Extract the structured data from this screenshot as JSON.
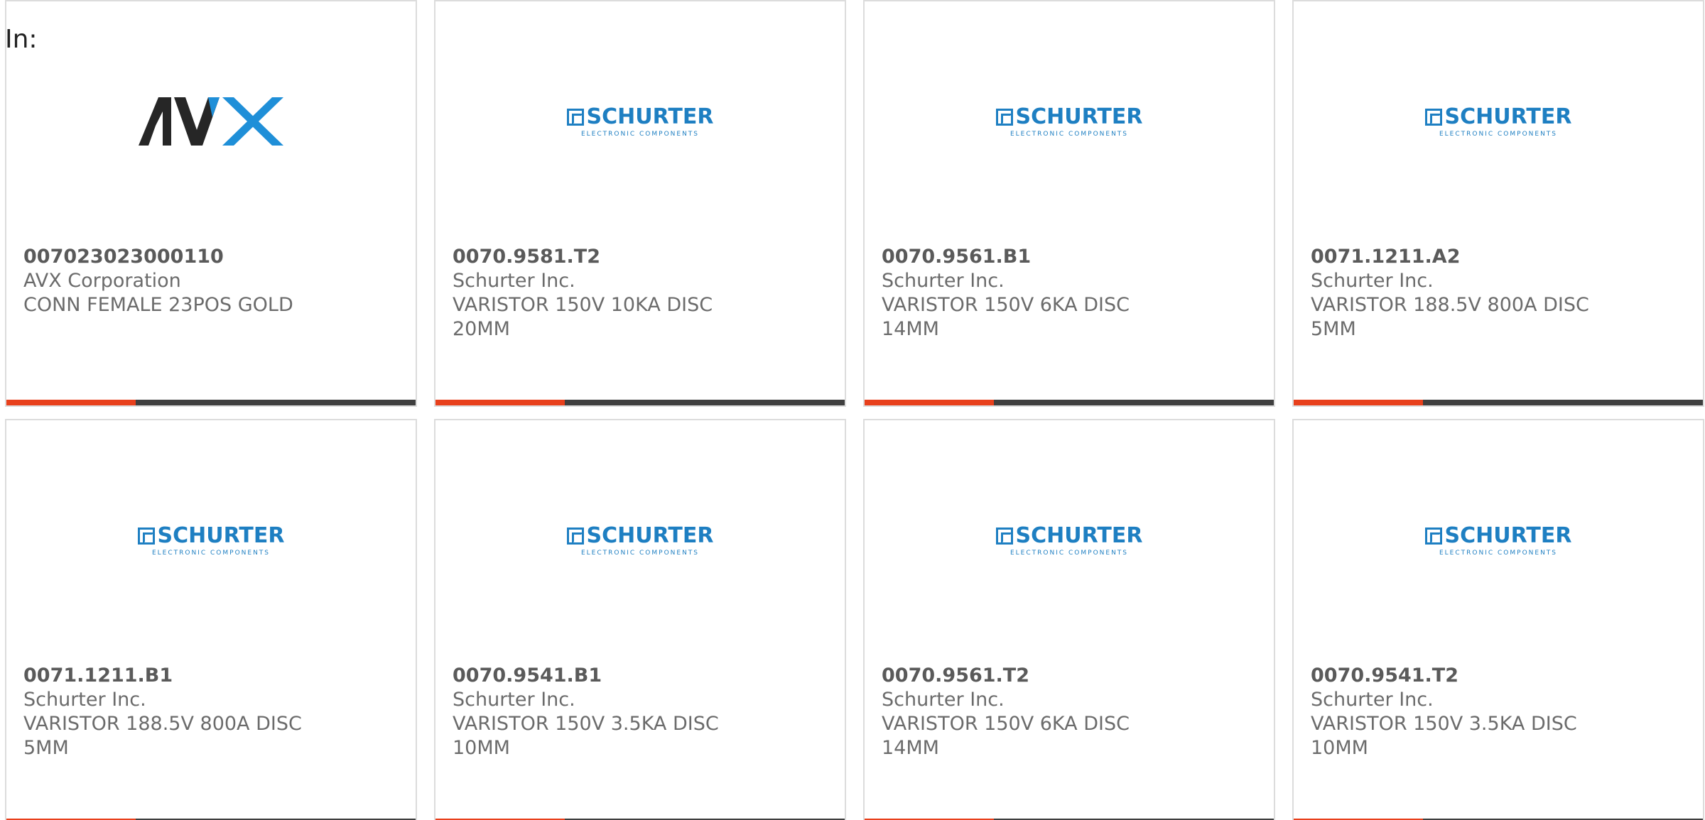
{
  "filter_label": "In:",
  "colors": {
    "accent": "#e8401c",
    "bar": "#3f3f3f",
    "avx_dark": "#262626",
    "avx_blue": "#1f8fd8",
    "schurter_blue": "#1e7fc2"
  },
  "cards": [
    {
      "logo": "avx-logo",
      "part_number": "007023023000110",
      "manufacturer": "AVX Corporation",
      "description": "CONN FEMALE 23POS GOLD"
    },
    {
      "logo": "schurter-logo",
      "logo_name": "SCHURTER",
      "logo_sub": "ELECTRONIC COMPONENTS",
      "part_number": "0070.9581.T2",
      "manufacturer": "Schurter Inc.",
      "description": "VARISTOR 150V 10KA DISC 20MM"
    },
    {
      "logo": "schurter-logo",
      "logo_name": "SCHURTER",
      "logo_sub": "ELECTRONIC COMPONENTS",
      "part_number": "0070.9561.B1",
      "manufacturer": "Schurter Inc.",
      "description": "VARISTOR 150V 6KA DISC 14MM"
    },
    {
      "logo": "schurter-logo",
      "logo_name": "SCHURTER",
      "logo_sub": "ELECTRONIC COMPONENTS",
      "part_number": "0071.1211.A2",
      "manufacturer": "Schurter Inc.",
      "description": "VARISTOR 188.5V 800A DISC 5MM"
    },
    {
      "logo": "schurter-logo",
      "logo_name": "SCHURTER",
      "logo_sub": "ELECTRONIC COMPONENTS",
      "part_number": "0071.1211.B1",
      "manufacturer": "Schurter Inc.",
      "description": "VARISTOR 188.5V 800A DISC 5MM"
    },
    {
      "logo": "schurter-logo",
      "logo_name": "SCHURTER",
      "logo_sub": "ELECTRONIC COMPONENTS",
      "part_number": "0070.9541.B1",
      "manufacturer": "Schurter Inc.",
      "description": "VARISTOR 150V 3.5KA DISC 10MM"
    },
    {
      "logo": "schurter-logo",
      "logo_name": "SCHURTER",
      "logo_sub": "ELECTRONIC COMPONENTS",
      "part_number": "0070.9561.T2",
      "manufacturer": "Schurter Inc.",
      "description": "VARISTOR 150V 6KA DISC 14MM"
    },
    {
      "logo": "schurter-logo",
      "logo_name": "SCHURTER",
      "logo_sub": "ELECTRONIC COMPONENTS",
      "part_number": "0070.9541.T2",
      "manufacturer": "Schurter Inc.",
      "description": "VARISTOR 150V 3.5KA DISC 10MM"
    }
  ]
}
